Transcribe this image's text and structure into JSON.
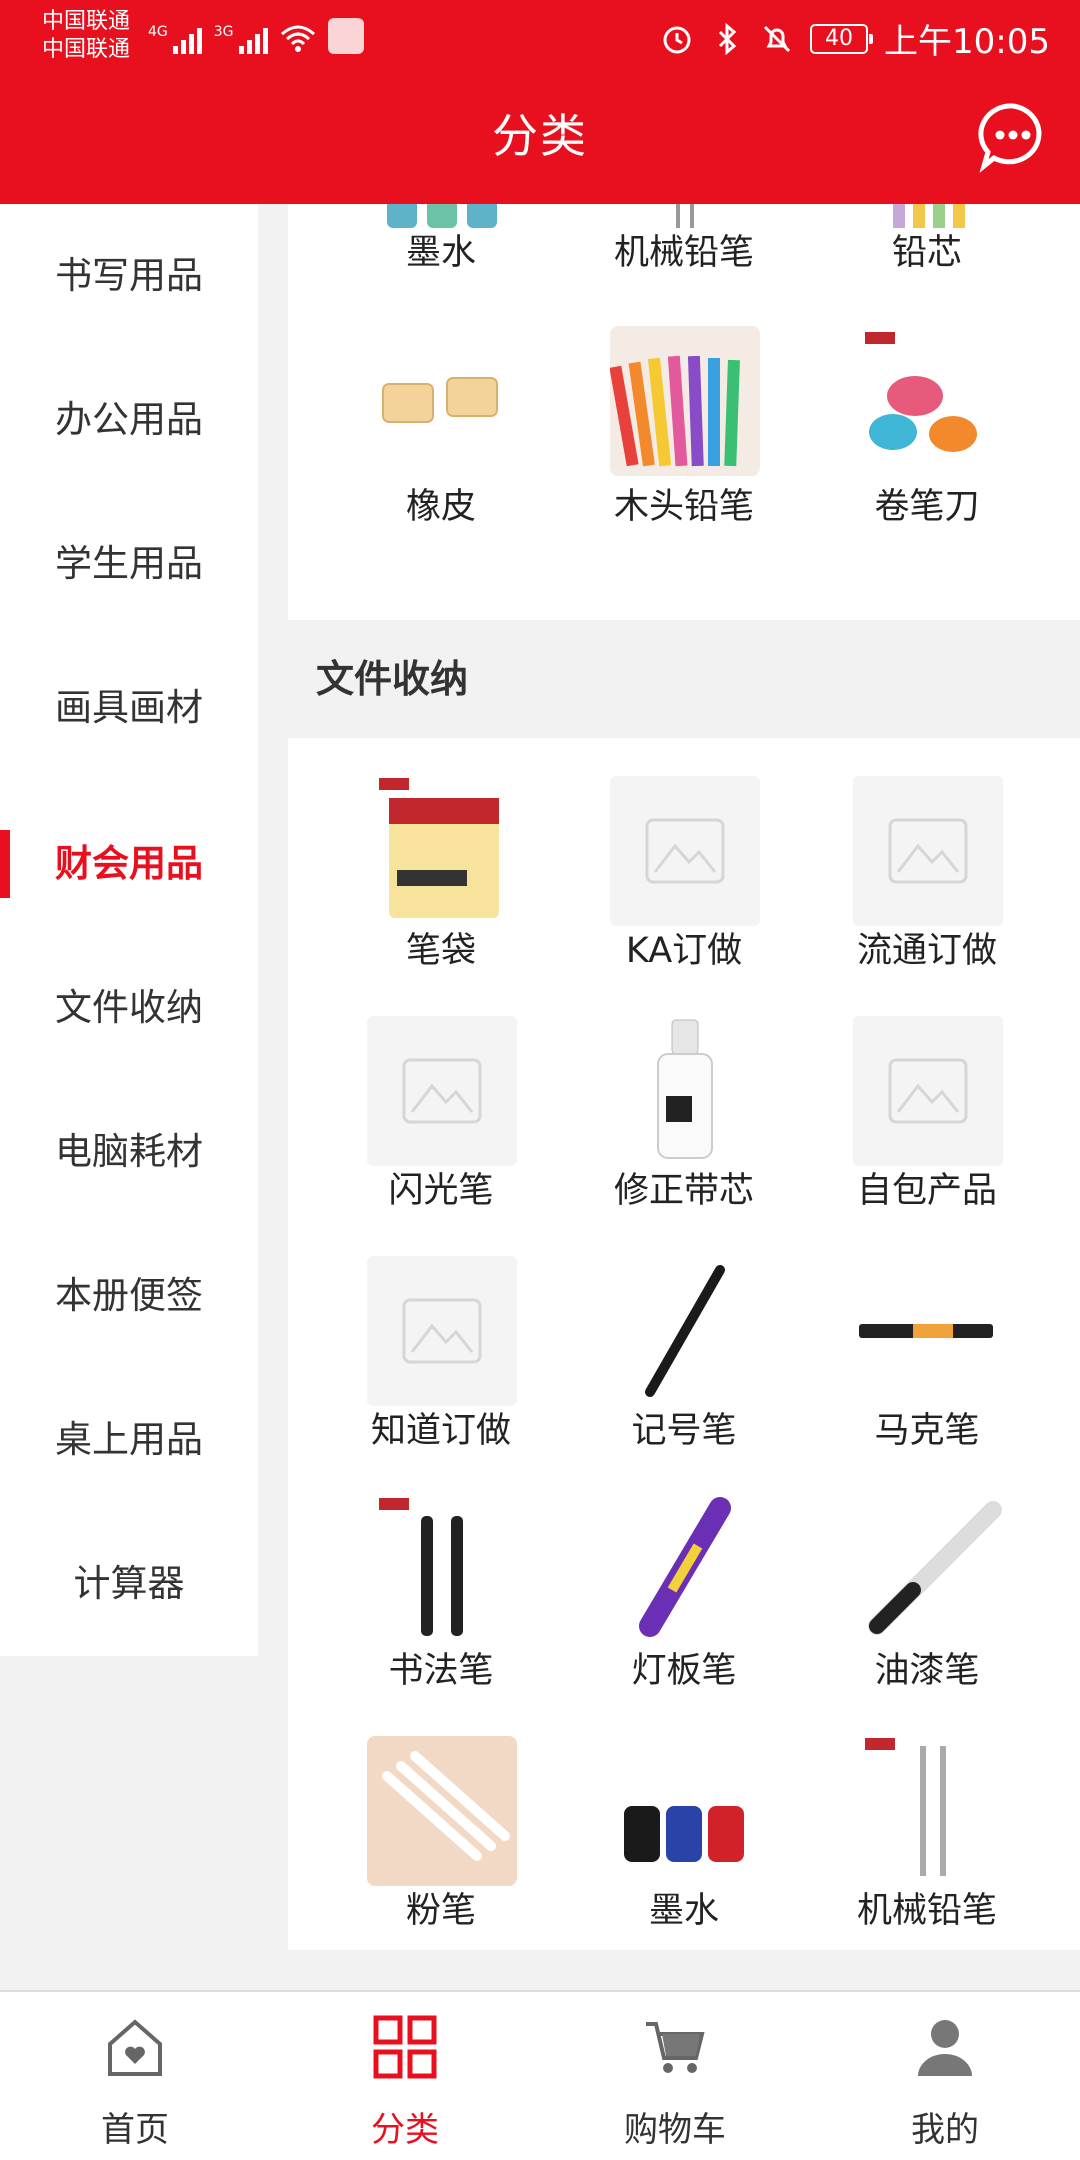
{
  "status_bar": {
    "carrier_line1": "中国联通",
    "carrier_line2": "中国联通",
    "net1": "4G",
    "net2": "3G",
    "battery": "40",
    "time": "上午10:05"
  },
  "header": {
    "title": "分类",
    "accent_color": "#e8101f"
  },
  "sidebar": {
    "items": [
      {
        "label": "书写用品"
      },
      {
        "label": "办公用品"
      },
      {
        "label": "学生用品"
      },
      {
        "label": "画具画材"
      },
      {
        "label": "财会用品",
        "active": true
      },
      {
        "label": "文件收纳"
      },
      {
        "label": "电脑耗材"
      },
      {
        "label": "本册便签"
      },
      {
        "label": "桌上用品"
      },
      {
        "label": "计算器"
      }
    ]
  },
  "content": {
    "top_items": [
      {
        "label": "墨水"
      },
      {
        "label": "机械铅笔"
      },
      {
        "label": "铅芯"
      },
      {
        "label": "橡皮",
        "icon": "eraser-icon"
      },
      {
        "label": "木头铅笔",
        "icon": "colored-pencils-icon"
      },
      {
        "label": "卷笔刀",
        "icon": "sharpener-icon"
      }
    ],
    "section": {
      "title": "文件收纳",
      "items": [
        {
          "label": "笔袋",
          "icon": "sticky-notes-icon"
        },
        {
          "label": "KA订做",
          "icon": "placeholder-image-icon"
        },
        {
          "label": "流通订做",
          "icon": "placeholder-image-icon"
        },
        {
          "label": "闪光笔",
          "icon": "placeholder-image-icon"
        },
        {
          "label": "修正带芯",
          "icon": "correction-fluid-icon"
        },
        {
          "label": "自包产品",
          "icon": "placeholder-image-icon"
        },
        {
          "label": "知道订做",
          "icon": "placeholder-image-icon"
        },
        {
          "label": "记号笔",
          "icon": "marker-pen-icon"
        },
        {
          "label": "马克笔",
          "icon": "marker-icon"
        },
        {
          "label": "书法笔",
          "icon": "brush-pen-icon"
        },
        {
          "label": "灯板笔",
          "icon": "led-board-pen-icon"
        },
        {
          "label": "油漆笔",
          "icon": "paint-pen-icon"
        },
        {
          "label": "粉笔",
          "icon": "chalk-markers-icon"
        },
        {
          "label": "墨水",
          "icon": "ink-bottles-icon"
        },
        {
          "label": "机械铅笔",
          "icon": "mechanical-pencil-icon"
        }
      ]
    }
  },
  "tabbar": {
    "tabs": [
      {
        "label": "首页",
        "icon": "home-icon"
      },
      {
        "label": "分类",
        "icon": "category-icon",
        "active": true
      },
      {
        "label": "购物车",
        "icon": "cart-icon"
      },
      {
        "label": "我的",
        "icon": "user-icon"
      }
    ]
  }
}
